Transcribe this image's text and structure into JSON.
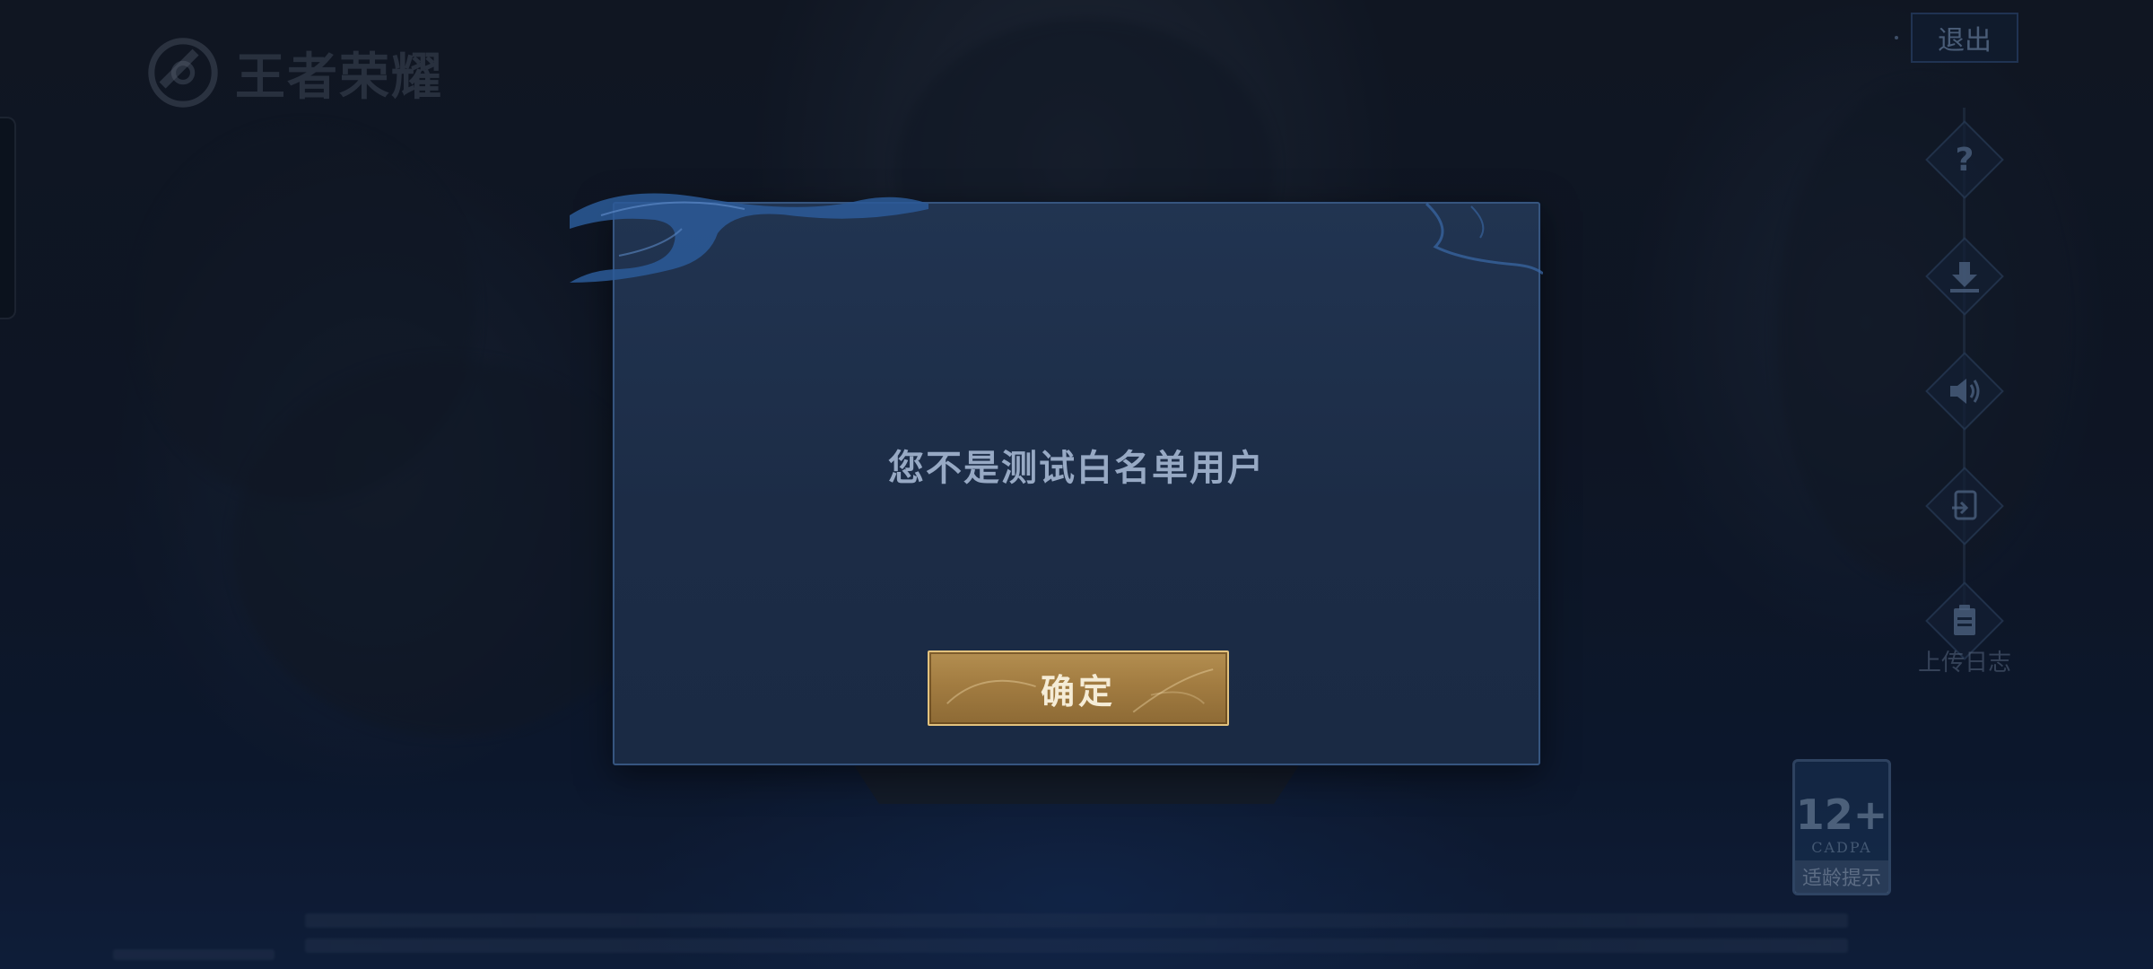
{
  "app": {
    "logo_text": "王者荣耀"
  },
  "header": {
    "exit_label": "退出"
  },
  "side_menu": {
    "items": [
      {
        "icon": "help-icon"
      },
      {
        "icon": "download-icon"
      },
      {
        "icon": "volume-icon"
      },
      {
        "icon": "switch-account-icon"
      },
      {
        "icon": "upload-log-icon"
      }
    ],
    "upload_log_label": "上传日志"
  },
  "age_rating": {
    "age": "12+",
    "org": "CADPA",
    "tip": "适龄提示"
  },
  "dialog": {
    "message": "您不是测试白名单用户",
    "confirm_label": "确定"
  }
}
